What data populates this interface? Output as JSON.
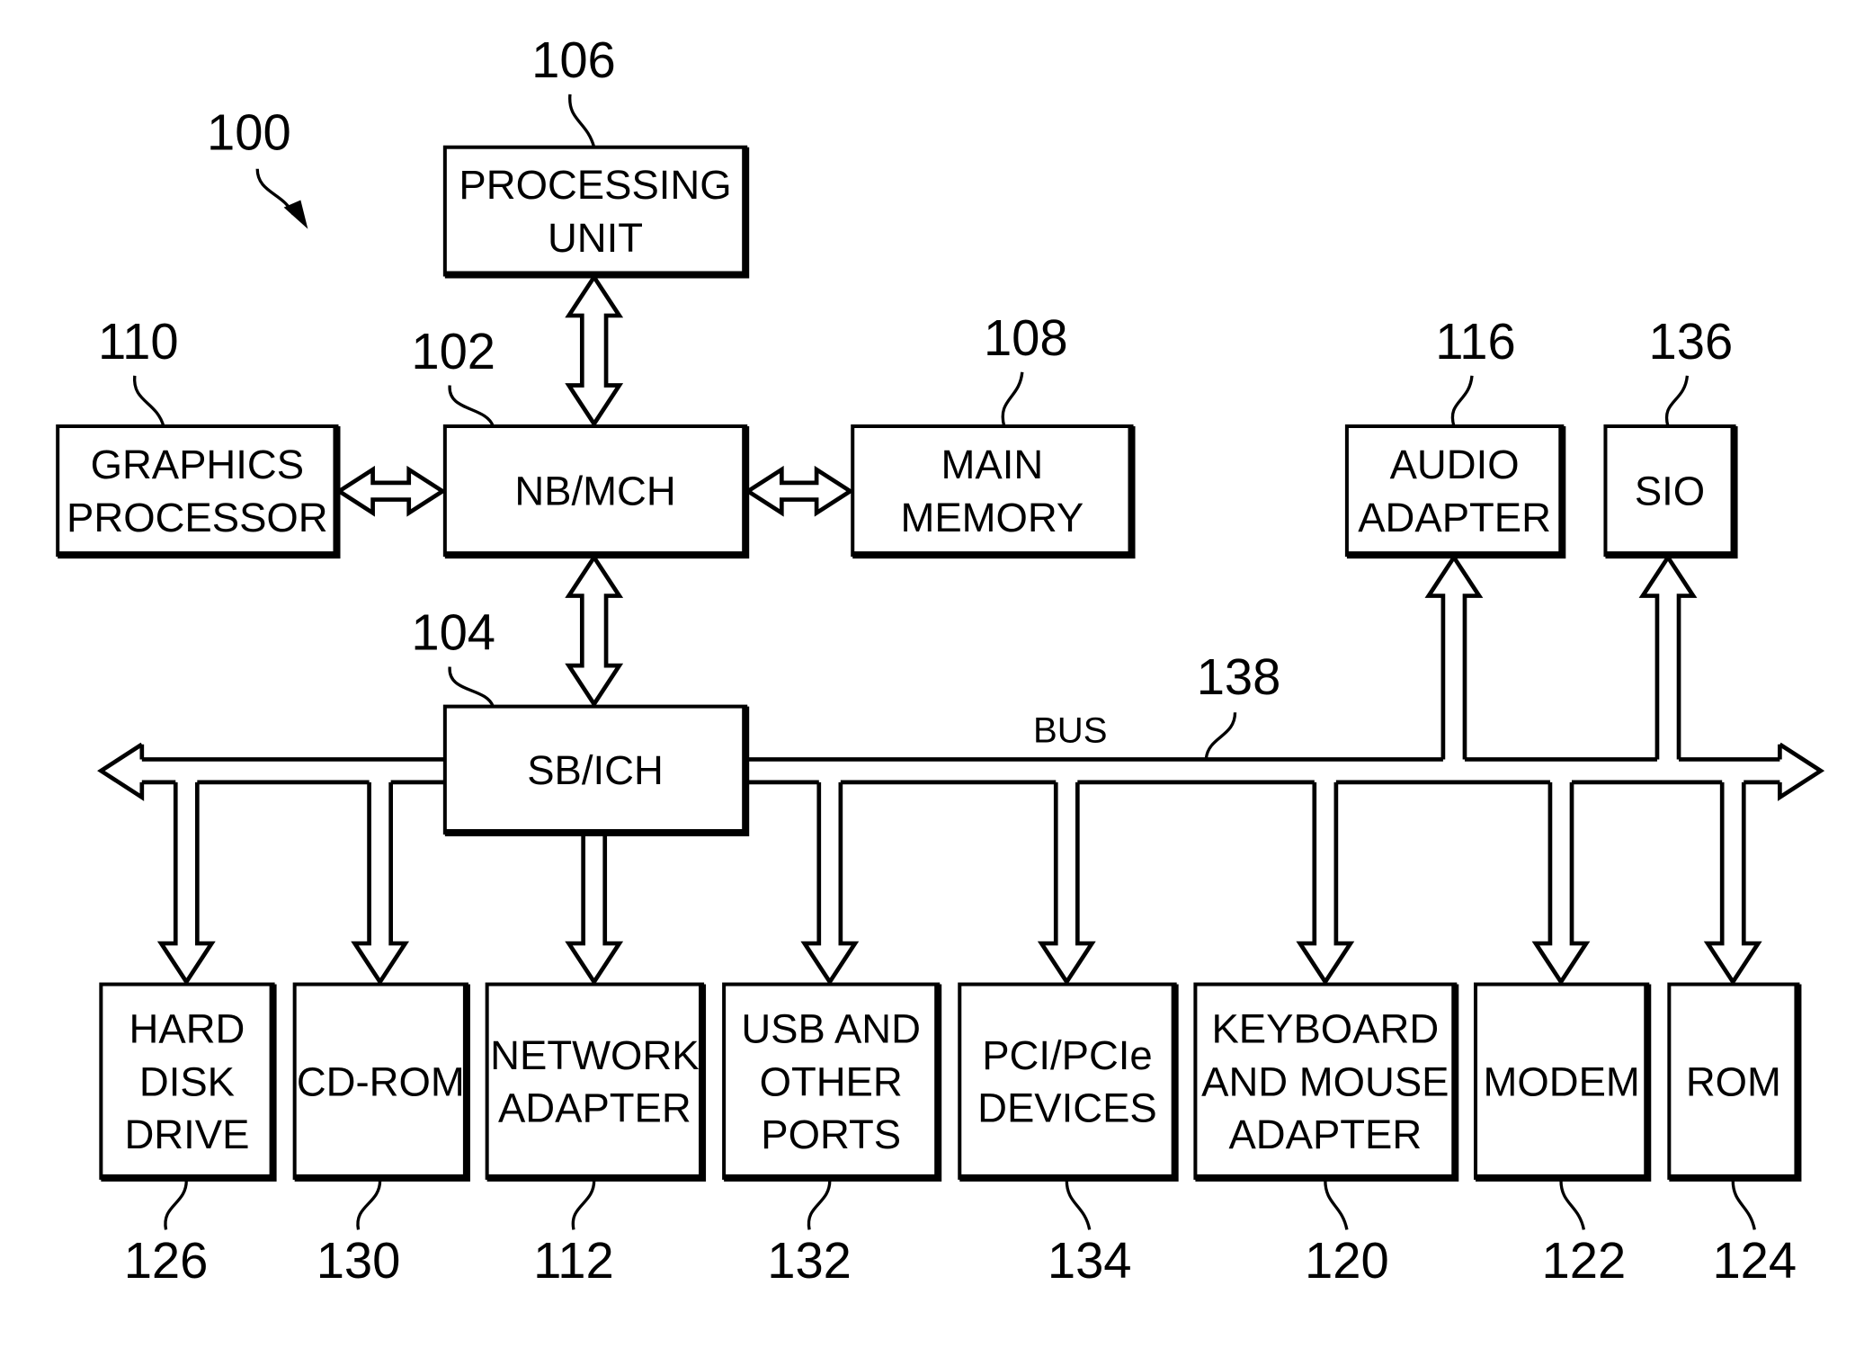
{
  "figure": {
    "ref": "100",
    "bus_label": "BUS",
    "bus_ref": "138"
  },
  "blocks": {
    "processing_unit": {
      "ref": "106",
      "lines": [
        "PROCESSING",
        "UNIT"
      ]
    },
    "graphics_processor": {
      "ref": "110",
      "lines": [
        "GRAPHICS",
        "PROCESSOR"
      ]
    },
    "nb_mch": {
      "ref": "102",
      "lines": [
        "NB/MCH"
      ]
    },
    "main_memory": {
      "ref": "108",
      "lines": [
        "MAIN",
        "MEMORY"
      ]
    },
    "audio_adapter": {
      "ref": "116",
      "lines": [
        "AUDIO",
        "ADAPTER"
      ]
    },
    "sio": {
      "ref": "136",
      "lines": [
        "SIO"
      ]
    },
    "sb_ich": {
      "ref": "104",
      "lines": [
        "SB/ICH"
      ]
    },
    "hard_disk_drive": {
      "ref": "126",
      "lines": [
        "HARD",
        "DISK",
        "DRIVE"
      ]
    },
    "cd_rom": {
      "ref": "130",
      "lines": [
        "CD-ROM"
      ]
    },
    "network_adapter": {
      "ref": "112",
      "lines": [
        "NETWORK",
        "ADAPTER"
      ]
    },
    "usb_ports": {
      "ref": "132",
      "lines": [
        "USB AND",
        "OTHER",
        "PORTS"
      ]
    },
    "pci_devices": {
      "ref": "134",
      "lines": [
        "PCI/PCIe",
        "DEVICES"
      ]
    },
    "keyboard_mouse_adapter": {
      "ref": "120",
      "lines": [
        "KEYBOARD",
        "AND MOUSE",
        "ADAPTER"
      ]
    },
    "modem": {
      "ref": "122",
      "lines": [
        "MODEM"
      ]
    },
    "rom": {
      "ref": "124",
      "lines": [
        "ROM"
      ]
    }
  },
  "colors": {
    "ink": "#000000",
    "paper": "#ffffff"
  }
}
